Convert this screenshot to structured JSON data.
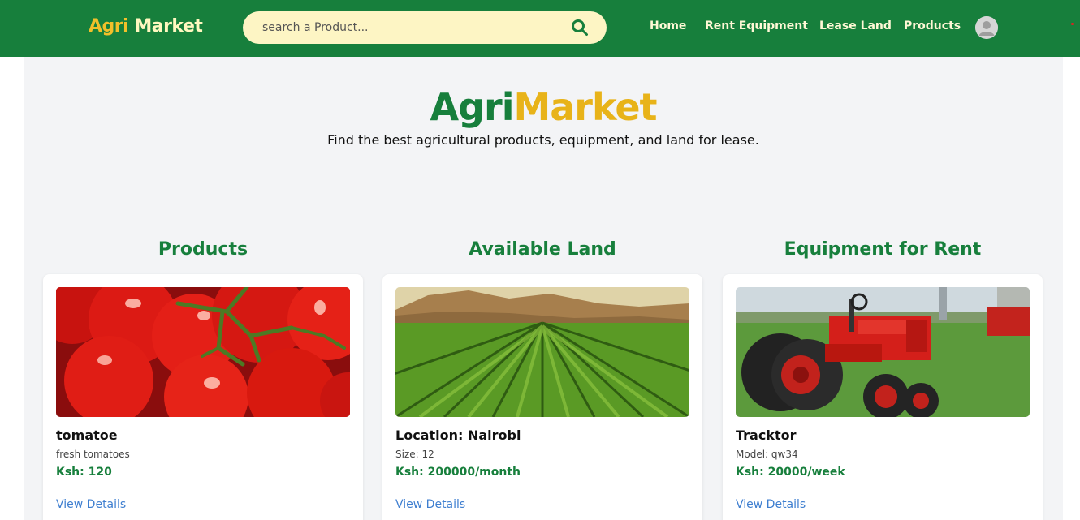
{
  "navbar": {
    "brand_part1": "Agri",
    "brand_part2": "Market",
    "search_placeholder": "search a Product...",
    "links": [
      "Home",
      "Rent Equipment",
      "Lease Land",
      "Products"
    ]
  },
  "hero": {
    "title_part1": "Agri",
    "title_part2": "Market",
    "subtitle": "Find the best agricultural products, equipment, and land for lease."
  },
  "columns": [
    {
      "heading": "Products",
      "card": {
        "title": "tomatoe",
        "description": "fresh tomatoes",
        "price": "Ksh: 120",
        "link": "View Details"
      }
    },
    {
      "heading": "Available Land",
      "card": {
        "title": "Location: Nairobi",
        "description": "Size: 12",
        "price": "Ksh: 200000/month",
        "link": "View Details"
      }
    },
    {
      "heading": "Equipment for Rent",
      "card": {
        "title": "Tracktor",
        "description": "Model: qw34",
        "price": "Ksh: 20000/week",
        "link": "View Details"
      }
    }
  ],
  "colors": {
    "primary_green": "#177f3c",
    "accent_yellow": "#e8b319",
    "link_blue": "#3f7fd0",
    "search_bg": "#fdf5c4"
  },
  "icons": {
    "search": "search-icon",
    "avatar": "user-avatar-icon"
  }
}
